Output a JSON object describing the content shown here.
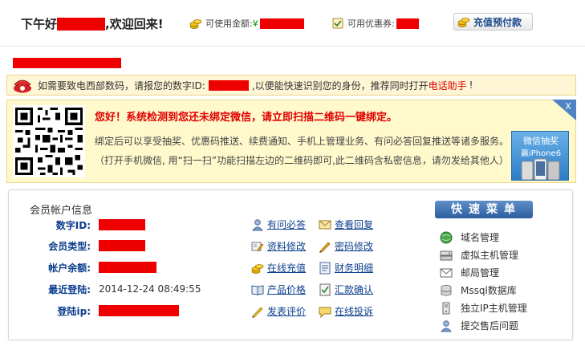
{
  "header": {
    "greeting": "下午好",
    "welcome": ",欢迎回来!",
    "balance_label": "可使用金额:",
    "currency": "¥",
    "coupon_label": "可用优惠券:",
    "prepay_button": "充值预付款"
  },
  "phone_notice": {
    "text_before": "如需要致电西部数码，请报您的数字ID:",
    "text_after": ",以便能快速识别您的身份，推荐同时打开",
    "link": "电话助手",
    "end": "!"
  },
  "wechat_notice": {
    "title": "您好！系统检测到您还未绑定微信，请立即扫描二维码一键绑定。",
    "desc": "绑定后可以享受抽奖、优惠码推送、续费通知、手机上管理业务、有问必答回复推送等诸多服务。",
    "desc2": "（打开手机微信, 用“扫一扫”功能扫描左边的二维码即可,此二维码含私密信息，请勿发给其他人）",
    "ad_line1": "微信抽奖",
    "ad_line2": "赢iPhone6",
    "close_label": "X"
  },
  "member": {
    "title": "会员帐户信息",
    "rows": [
      {
        "label": "数字ID:",
        "value": ""
      },
      {
        "label": "会员类型:",
        "value": ""
      },
      {
        "label": "帐户余额:",
        "value": ""
      },
      {
        "label": "最近登陆:",
        "value": "2014-12-24 08:49:55"
      },
      {
        "label": "登陆ip:",
        "value": ""
      }
    ],
    "links": [
      {
        "label": "有问必答",
        "icon": "user-question-icon"
      },
      {
        "label": "查看回复",
        "icon": "envelope-icon"
      },
      {
        "label": "资料修改",
        "icon": "profile-edit-icon"
      },
      {
        "label": "密码修改",
        "icon": "pencil-icon"
      },
      {
        "label": "在线充值",
        "icon": "coins-icon"
      },
      {
        "label": "财务明细",
        "icon": "ledger-icon"
      },
      {
        "label": "产品价格",
        "icon": "book-icon"
      },
      {
        "label": "汇款确认",
        "icon": "checklist-icon"
      },
      {
        "label": "发表评价",
        "icon": "comment-pen-icon"
      },
      {
        "label": "在线投诉",
        "icon": "speech-bubble-icon"
      }
    ]
  },
  "quick_menu": {
    "title": "快速菜单",
    "items": [
      {
        "label": "域名管理",
        "icon": "globe-icon"
      },
      {
        "label": "虚拟主机管理",
        "icon": "server-icon"
      },
      {
        "label": "邮局管理",
        "icon": "mail-icon"
      },
      {
        "label": "Mssql数据库",
        "icon": "database-icon"
      },
      {
        "label": "独立IP主机管理",
        "icon": "tower-icon"
      },
      {
        "label": "提交售后问题",
        "icon": "support-user-icon"
      }
    ]
  },
  "colors": {
    "accent_blue": "#0b3e8c",
    "alert_red": "#e00000",
    "notice_bg": "#fff9cc"
  }
}
